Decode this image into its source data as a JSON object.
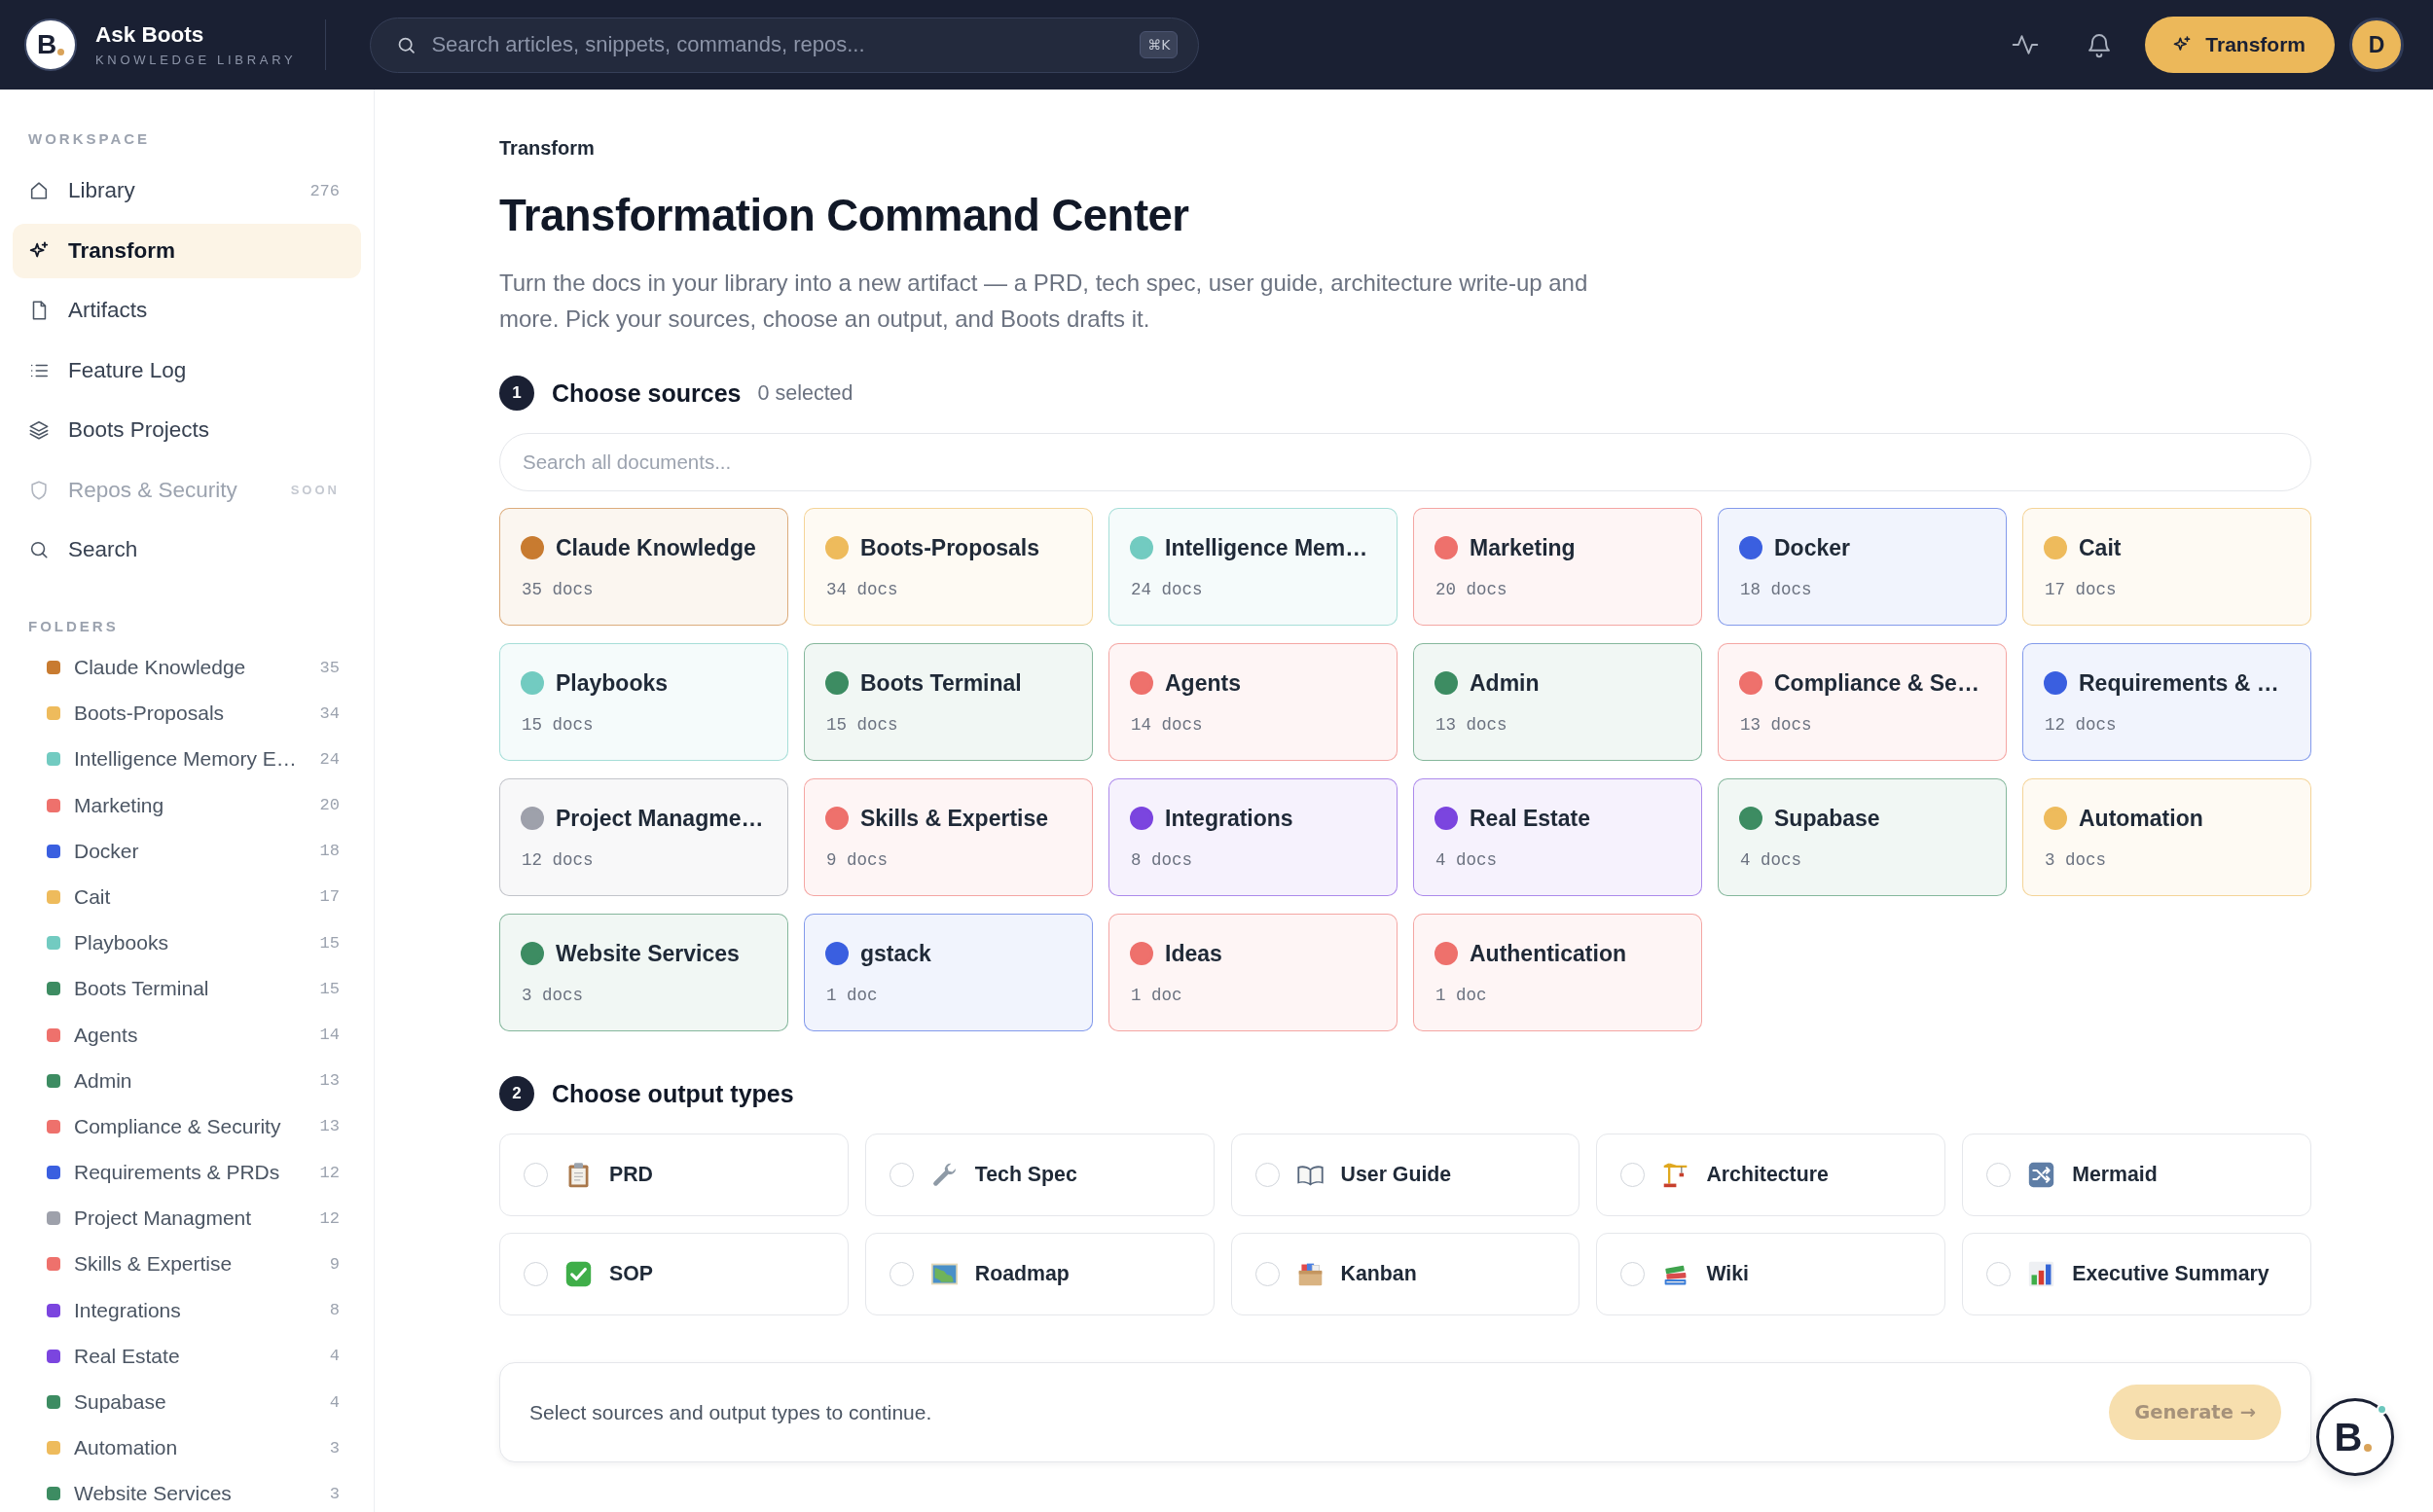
{
  "topbar": {
    "logo_letter": "B",
    "app_name": "Ask Boots",
    "tagline": "KNOWLEDGE LIBRARY",
    "search": {
      "placeholder": "Search articles, snippets, commands, repos...",
      "shortcut": "⌘K"
    },
    "action_button": "Transform",
    "avatar": "D"
  },
  "workspace": {
    "title": "WORKSPACE",
    "items": [
      {
        "label": "Library",
        "count": "276",
        "selected": false,
        "disabled": false
      },
      {
        "label": "Transform",
        "selected": true,
        "disabled": false
      },
      {
        "label": "Artifacts",
        "selected": false,
        "disabled": false
      },
      {
        "label": "Feature Log",
        "selected": false,
        "disabled": false
      },
      {
        "label": "Boots Projects",
        "selected": false,
        "disabled": false
      },
      {
        "label": "Repos & Security",
        "badge": "SOON",
        "selected": false,
        "disabled": true
      },
      {
        "label": "Search",
        "selected": false,
        "disabled": false
      }
    ]
  },
  "folders": {
    "title": "FOLDERS",
    "items": [
      {
        "name": "Claude Knowledge",
        "count": "35",
        "color": "#c87b30"
      },
      {
        "name": "Boots-Proposals",
        "count": "34",
        "color": "#eebb5c"
      },
      {
        "name": "Intelligence Memory E…",
        "count": "24",
        "color": "#72cbc1"
      },
      {
        "name": "Marketing",
        "count": "20",
        "color": "#ee716c"
      },
      {
        "name": "Docker",
        "count": "18",
        "color": "#3a5fe0"
      },
      {
        "name": "Cait",
        "count": "17",
        "color": "#eebb5c"
      },
      {
        "name": "Playbooks",
        "count": "15",
        "color": "#72cbc1"
      },
      {
        "name": "Boots Terminal",
        "count": "15",
        "color": "#3d8c62"
      },
      {
        "name": "Agents",
        "count": "14",
        "color": "#ee716c"
      },
      {
        "name": "Admin",
        "count": "13",
        "color": "#3d8c62"
      },
      {
        "name": "Compliance & Security",
        "count": "13",
        "color": "#ee716c"
      },
      {
        "name": "Requirements & PRDs",
        "count": "12",
        "color": "#3a5fe0"
      },
      {
        "name": "Project Managment",
        "count": "12",
        "color": "#9ea1ab"
      },
      {
        "name": "Skills & Expertise",
        "count": "9",
        "color": "#ee716c"
      },
      {
        "name": "Integrations",
        "count": "8",
        "color": "#7b45df"
      },
      {
        "name": "Real Estate",
        "count": "4",
        "color": "#7b45df"
      },
      {
        "name": "Supabase",
        "count": "4",
        "color": "#3d8c62"
      },
      {
        "name": "Automation",
        "count": "3",
        "color": "#eebb5c"
      },
      {
        "name": "Website Services",
        "count": "3",
        "color": "#3d8c62"
      }
    ]
  },
  "breadcrumb": "Transform",
  "title": "Transformation Command Center",
  "description": "Turn the docs in your library into a new artifact — a PRD, tech spec, user guide, architecture write-up and more. Pick your sources, choose an output, and Boots drafts it.",
  "sources": {
    "step": "1",
    "title": "Choose sources",
    "hint": "0 selected",
    "search_placeholder": "Search all documents...",
    "folders": [
      {
        "name": "Claude Knowledge",
        "docs": "35 docs",
        "color": "#c87b30",
        "selected": false
      },
      {
        "name": "Boots-Proposals",
        "docs": "34 docs",
        "color": "#eebb5c",
        "selected": false
      },
      {
        "name": "Intelligence Mem…",
        "docs": "24 docs",
        "color": "#72cbc1",
        "selected": false
      },
      {
        "name": "Marketing",
        "docs": "20 docs",
        "color": "#ee716c",
        "selected": false
      },
      {
        "name": "Docker",
        "docs": "18 docs",
        "color": "#3a5fe0",
        "selected": false
      },
      {
        "name": "Cait",
        "docs": "17 docs",
        "color": "#eebb5c",
        "selected": false
      },
      {
        "name": "Playbooks",
        "docs": "15 docs",
        "color": "#72cbc1",
        "selected": false
      },
      {
        "name": "Boots Terminal",
        "docs": "15 docs",
        "color": "#3d8c62",
        "selected": false
      },
      {
        "name": "Agents",
        "docs": "14 docs",
        "color": "#ee716c",
        "selected": false
      },
      {
        "name": "Admin",
        "docs": "13 docs",
        "color": "#3d8c62",
        "selected": false
      },
      {
        "name": "Compliance & Se…",
        "docs": "13 docs",
        "color": "#ee716c",
        "selected": false
      },
      {
        "name": "Requirements & …",
        "docs": "12 docs",
        "color": "#3a5fe0",
        "selected": false
      },
      {
        "name": "Project Managme…",
        "docs": "12 docs",
        "color": "#9ea1ab",
        "selected": false
      },
      {
        "name": "Skills & Expertise",
        "docs": "9 docs",
        "color": "#ee716c",
        "selected": false
      },
      {
        "name": "Integrations",
        "docs": "8 docs",
        "color": "#7b45df",
        "selected": false
      },
      {
        "name": "Real Estate",
        "docs": "4 docs",
        "color": "#7b45df",
        "selected": false
      },
      {
        "name": "Supabase",
        "docs": "4 docs",
        "color": "#3d8c62",
        "selected": false
      },
      {
        "name": "Automation",
        "docs": "3 docs",
        "color": "#eebb5c",
        "selected": false
      },
      {
        "name": "Website Services",
        "docs": "3 docs",
        "color": "#3d8c62",
        "selected": false
      },
      {
        "name": "gstack",
        "docs": "1 doc",
        "color": "#3a5fe0",
        "selected": false
      },
      {
        "name": "Ideas",
        "docs": "1 doc",
        "color": "#ee716c",
        "selected": false
      },
      {
        "name": "Authentication",
        "docs": "1 doc",
        "color": "#ee716c",
        "selected": false
      }
    ]
  },
  "outputs": {
    "step": "2",
    "title": "Choose output types",
    "types": [
      {
        "label": "PRD",
        "selected": false
      },
      {
        "label": "Tech Spec",
        "selected": false
      },
      {
        "label": "User Guide",
        "selected": false
      },
      {
        "label": "Architecture",
        "selected": false
      },
      {
        "label": "Mermaid",
        "selected": false
      },
      {
        "label": "SOP",
        "selected": false
      },
      {
        "label": "Roadmap",
        "selected": false
      },
      {
        "label": "Kanban",
        "selected": false
      },
      {
        "label": "Wiki",
        "selected": false
      },
      {
        "label": "Executive Summary",
        "selected": false
      }
    ]
  },
  "footer": {
    "message": "Select sources and output types to continue.",
    "button": "Generate →",
    "disabled": true
  },
  "fab": {
    "letter": "B"
  }
}
